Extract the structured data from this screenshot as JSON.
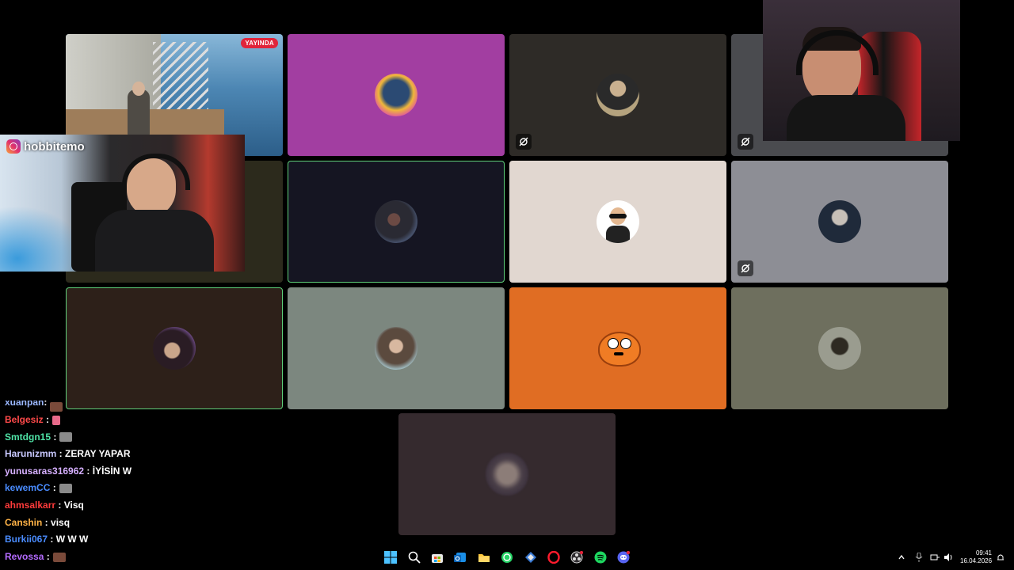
{
  "stream": {
    "live_badge": "YAYINDA",
    "instagram_handle": "hobbitemo"
  },
  "call_tiles": [
    {
      "id": "game",
      "bg": "#3d6f96",
      "speaking": false,
      "muted": false
    },
    {
      "id": "p2",
      "bg": "#a23ea1",
      "speaking": false,
      "muted": false
    },
    {
      "id": "p3",
      "bg": "#2e2b27",
      "speaking": false,
      "muted": true
    },
    {
      "id": "p4",
      "bg": "#4a4b4f",
      "speaking": false,
      "muted": true
    },
    {
      "id": "p5",
      "bg": "#2c2a1c",
      "speaking": false,
      "muted": false
    },
    {
      "id": "p6",
      "bg": "#151522",
      "speaking": true,
      "muted": false
    },
    {
      "id": "p7",
      "bg": "#e1d7d0",
      "speaking": false,
      "muted": false
    },
    {
      "id": "p8",
      "bg": "#8d8e95",
      "speaking": false,
      "muted": true
    },
    {
      "id": "p9",
      "bg": "#2d2019",
      "speaking": true,
      "muted": false
    },
    {
      "id": "p10",
      "bg": "#7c877f",
      "speaking": false,
      "muted": false
    },
    {
      "id": "p11",
      "bg": "#e06d23",
      "speaking": false,
      "muted": false
    },
    {
      "id": "p12",
      "bg": "#6e6f5e",
      "speaking": false,
      "muted": false
    },
    {
      "id": "p13",
      "bg": "#352a2e",
      "speaking": false,
      "muted": false
    }
  ],
  "chat": [
    {
      "user": "xuanpan",
      "color": "#9bb8ff",
      "message": "",
      "emote": true
    },
    {
      "user": "Belgesiz",
      "color": "#ff4a4a",
      "message": "",
      "emote": true
    },
    {
      "user": "Smtdgn15",
      "color": "#4fe3a6",
      "message": "",
      "emote": true
    },
    {
      "user": "Harunizmm",
      "color": "#c9c9ff",
      "message": "ZERAY YAPAR",
      "emote": false
    },
    {
      "user": "yunusaras316962",
      "color": "#d6b0ff",
      "message": "İYİSİN W",
      "emote": false
    },
    {
      "user": "kewemCC",
      "color": "#4a8cff",
      "message": "",
      "emote": true
    },
    {
      "user": "ahmsalkarr",
      "color": "#ff3b3b",
      "message": "Visq",
      "emote": false
    },
    {
      "user": "Canshin",
      "color": "#ffb347",
      "message": "visq",
      "emote": false
    },
    {
      "user": "Burkii067",
      "color": "#4a8cff",
      "message": "W W W",
      "emote": false
    },
    {
      "user": "Revossa",
      "color": "#b46bff",
      "message": "",
      "emote": true
    }
  ],
  "taskbar": {
    "time": "09:41",
    "date": "16.04.2026"
  }
}
